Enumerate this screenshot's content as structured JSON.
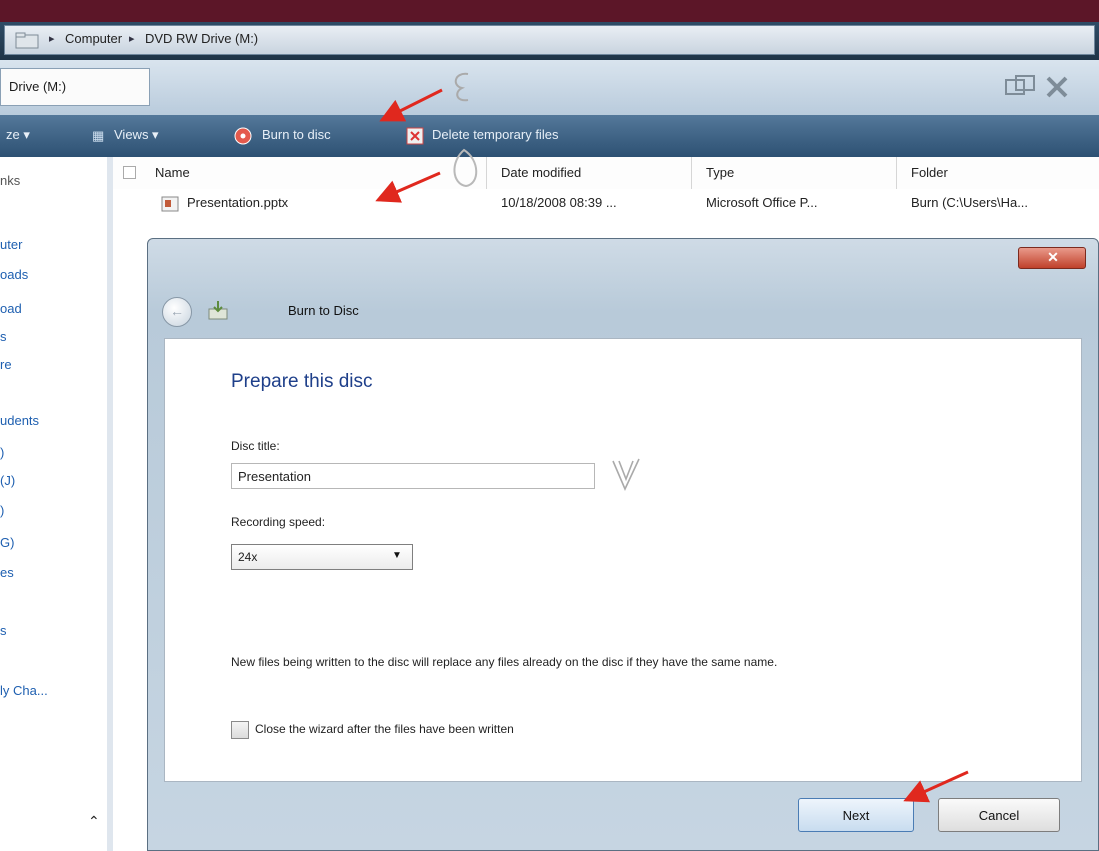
{
  "breadcrumb": {
    "parts": [
      "Computer",
      "DVD RW Drive (M:)"
    ],
    "separator": "▸"
  },
  "tab": {
    "label": "Drive (M:)"
  },
  "toolbar": {
    "organize_label": "ze ▾",
    "views_label": "Views ▾",
    "burn_label": "Burn to disc",
    "delete_label": "Delete temporary files"
  },
  "left_nav": {
    "items": [
      "nks",
      "uter",
      "oads",
      "oad",
      "s",
      "re",
      "udents",
      ")",
      "(J)",
      ")",
      "G)",
      "es",
      "s",
      "ly Cha..."
    ]
  },
  "columns": {
    "name": "Name",
    "date": "Date modified",
    "type": "Type",
    "folder": "Folder"
  },
  "files": [
    {
      "name": "Presentation.pptx",
      "date": "10/18/2008 08:39 ...",
      "type": "Microsoft Office P...",
      "folder": "Burn (C:\\Users\\Ha..."
    }
  ],
  "dialog": {
    "title": "Burn to Disc",
    "close_glyph": "✕",
    "heading": "Prepare this disc",
    "disc_title_label": "Disc title:",
    "disc_title_value": "Presentation",
    "speed_label": "Recording speed:",
    "speed_value": "24x",
    "note": "New files being written to the disc will replace any files already on the disc if they have the same name.",
    "close_wizard_label": "Close the wizard after the files have been written",
    "close_wizard_checked": false,
    "next_label": "Next",
    "cancel_label": "Cancel"
  },
  "colors": {
    "accent_arrow": "#e0281e",
    "toolbar": "#3c6285",
    "heading": "#1e3f8a"
  }
}
